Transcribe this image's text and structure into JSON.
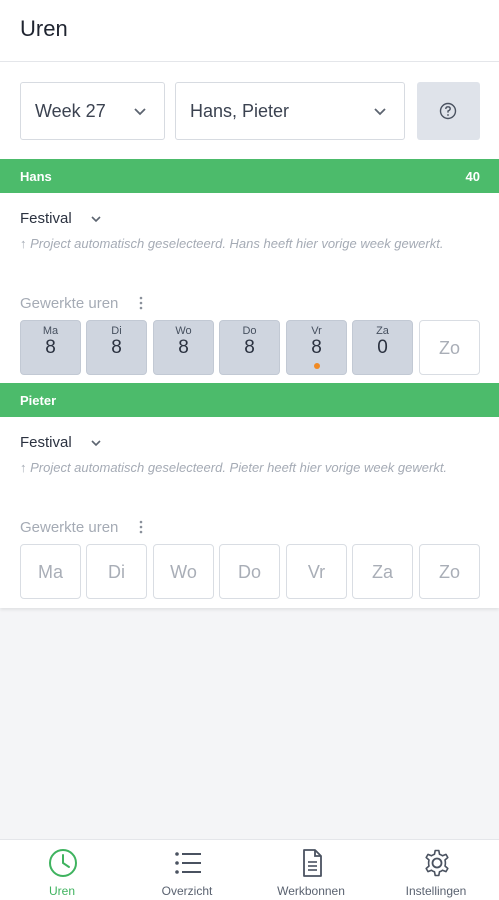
{
  "header": {
    "title": "Uren"
  },
  "filters": {
    "week": "Week 27",
    "persons": "Hans, Pieter"
  },
  "colors": {
    "accent": "#4cbb6b",
    "dot": "#f08a24"
  },
  "persons": [
    {
      "name": "Hans",
      "total": "40",
      "project": "Festival",
      "hint": "↑ Project automatisch geselecteerd. Hans heeft hier vorige week gewerkt.",
      "hours_label": "Gewerkte uren",
      "days": [
        {
          "abbr": "Ma",
          "value": "8"
        },
        {
          "abbr": "Di",
          "value": "8"
        },
        {
          "abbr": "Wo",
          "value": "8"
        },
        {
          "abbr": "Do",
          "value": "8"
        },
        {
          "abbr": "Vr",
          "value": "8"
        },
        {
          "abbr": "Za",
          "value": "0"
        },
        {
          "abbr": "Zo",
          "value": ""
        }
      ]
    },
    {
      "name": "Pieter",
      "total": "",
      "project": "Festival",
      "hint": "↑ Project automatisch geselecteerd. Pieter heeft hier vorige week gewerkt.",
      "hours_label": "Gewerkte uren",
      "days": [
        {
          "abbr": "Ma",
          "value": ""
        },
        {
          "abbr": "Di",
          "value": ""
        },
        {
          "abbr": "Wo",
          "value": ""
        },
        {
          "abbr": "Do",
          "value": ""
        },
        {
          "abbr": "Vr",
          "value": ""
        },
        {
          "abbr": "Za",
          "value": ""
        },
        {
          "abbr": "Zo",
          "value": ""
        }
      ]
    }
  ],
  "nav": [
    {
      "label": "Uren",
      "icon": "clock-icon",
      "active": true
    },
    {
      "label": "Overzicht",
      "icon": "list-icon",
      "active": false
    },
    {
      "label": "Werkbonnen",
      "icon": "document-icon",
      "active": false
    },
    {
      "label": "Instellingen",
      "icon": "gear-icon",
      "active": false
    }
  ]
}
